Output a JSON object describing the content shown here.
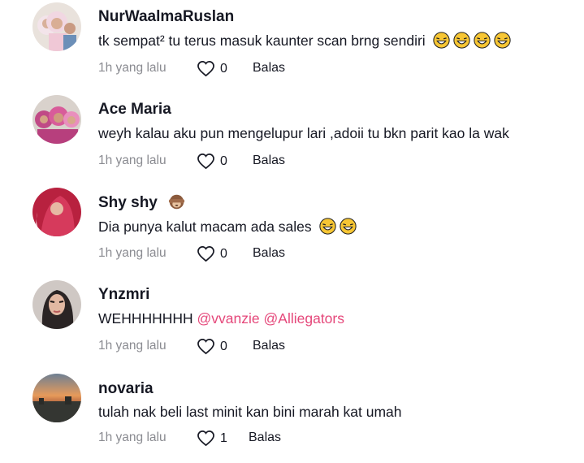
{
  "comments": [
    {
      "username": "NurWaalmaRuslan",
      "text": "tk sempat² tu terus masuk kaunter scan brng sendiri",
      "emojis": [
        "grinning-squint-tears",
        "grinning-squint-tears",
        "grinning-squint-tears",
        "grinning-squint-tears"
      ],
      "time": "1h yang lalu",
      "likes": "0",
      "reply_label": "Balas"
    },
    {
      "username": "Ace Maria",
      "text": "weyh kalau aku pun mengelupur lari ,adoii tu bkn parit kao la wak",
      "time": "1h yang lalu",
      "likes": "0",
      "reply_label": "Balas"
    },
    {
      "username": "Shy  shy",
      "username_emoji": "see-no-evil-monkey",
      "text": "Dia punya kalut macam ada sales",
      "emojis": [
        "grinning-squint-tears",
        "grinning-squint-tears"
      ],
      "time": "1h yang lalu",
      "likes": "0",
      "reply_label": "Balas"
    },
    {
      "username": "Ynzmri",
      "text": "WEHHHHHHH",
      "mentions": [
        "@vvanzie",
        "@Alliegators"
      ],
      "time": "1h yang lalu",
      "likes": "0",
      "reply_label": "Balas"
    },
    {
      "username": "novaria",
      "text": "tulah nak beli last minit kan bini marah kat umah",
      "time": "1h yang lalu",
      "likes": "1",
      "reply_label": "Balas"
    }
  ],
  "colors": {
    "text": "#161823",
    "muted": "#8a8b91",
    "mention": "#e5477a",
    "background": "#ffffff"
  },
  "icons": {
    "like": "heart-outline-icon",
    "emoji_laugh": "grinning-squint-tears",
    "emoji_monkey": "see-no-evil-monkey"
  }
}
